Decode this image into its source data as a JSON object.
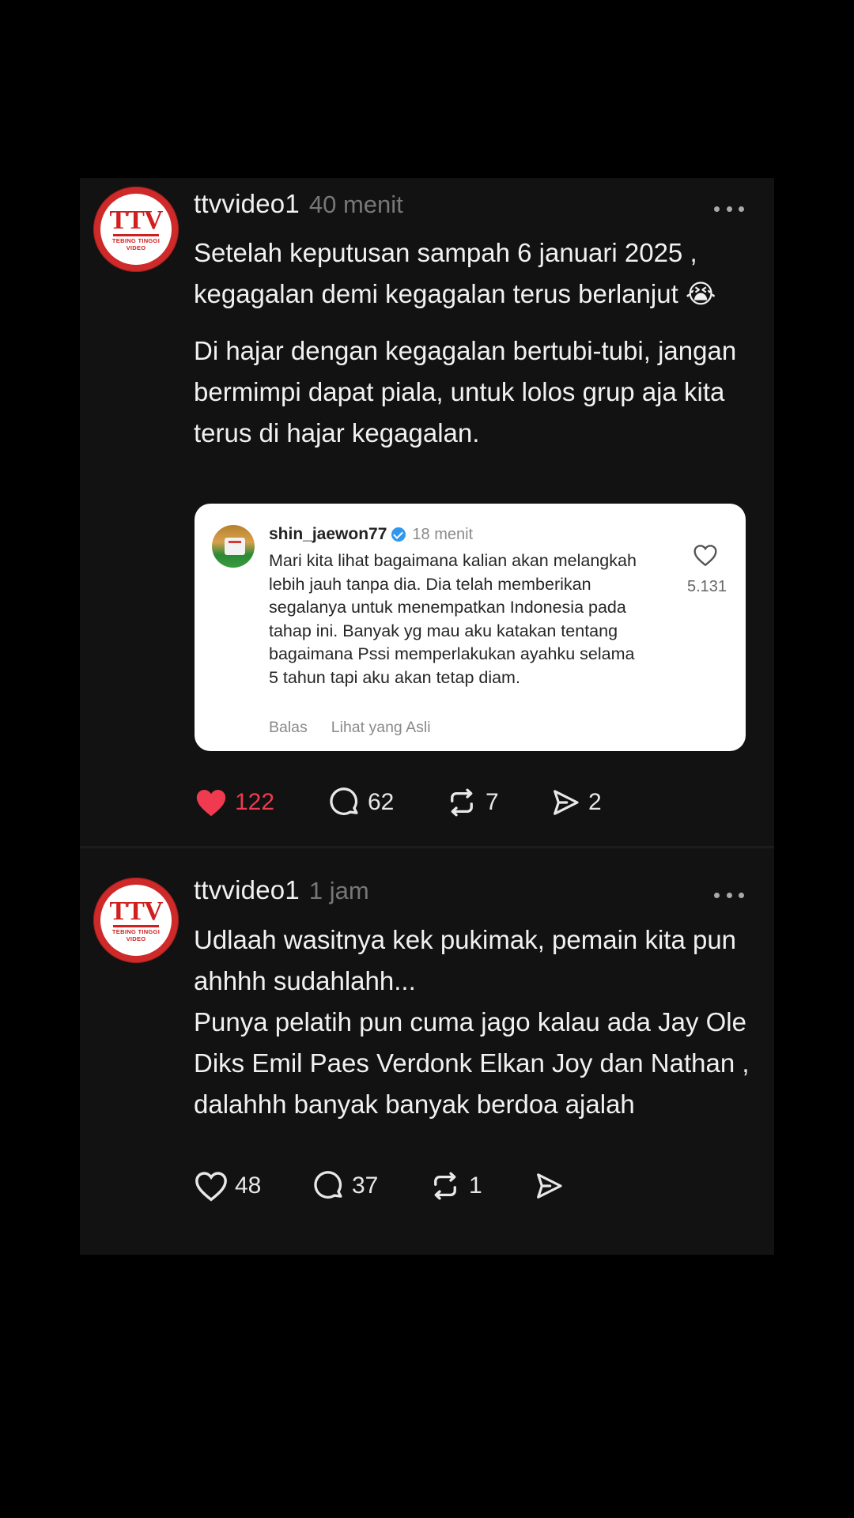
{
  "posts": [
    {
      "username": "ttvvideo1",
      "time": "40 menit",
      "avatar": {
        "main": "TTV",
        "sub1": "TEBING TINGGI",
        "sub2": "VIDEO"
      },
      "paragraphs": [
        "Setelah keputusan sampah 6 januari 2025 , kegagalan demi kegagalan terus berlanjut 😭",
        "Di hajar dengan kegagalan bertubi-tubi, jangan bermimpi dapat piala, untuk lolos grup aja kita terus di hajar kegagalan."
      ],
      "quote": {
        "username": "shin_jaewon77",
        "time": "18 menit",
        "text": "Mari kita lihat bagaimana kalian akan melangkah lebih jauh tanpa dia. Dia telah memberikan segalanya untuk menempatkan Indonesia pada tahap ini. Banyak yg mau aku katakan tentang bagaimana Pssi memperlakukan ayahku selama 5 tahun tapi aku akan tetap diam.",
        "likes": "5.131",
        "reply_label": "Balas",
        "original_label": "Lihat yang Asli"
      },
      "stats": {
        "likes": "122",
        "liked": true,
        "comments": "62",
        "reposts": "7",
        "shares": "2"
      }
    },
    {
      "username": "ttvvideo1",
      "time": "1 jam",
      "avatar": {
        "main": "TTV",
        "sub1": "TEBING TINGGI",
        "sub2": "VIDEO"
      },
      "paragraphs": [
        "Udlaah wasitnya kek pukimak, pemain kita pun ahhhh sudahlahh...",
        "Punya pelatih pun cuma jago kalau ada Jay Ole Diks Emil Paes Verdonk Elkan Joy dan Nathan , dalahhh banyak banyak berdoa ajalah"
      ],
      "stats": {
        "likes": "48",
        "liked": false,
        "comments": "37",
        "reposts": "1",
        "shares": ""
      }
    }
  ],
  "colors": {
    "background": "#000000",
    "card": "#121212",
    "liked": "#ef3a4f",
    "verified": "#2f97ef",
    "avatar": "#ce2a2a"
  }
}
